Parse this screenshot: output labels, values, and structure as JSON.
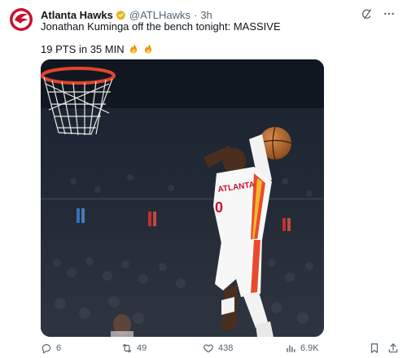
{
  "tweet": {
    "author_name": "Atlanta Hawks",
    "handle": "@ATLHawks",
    "separator": "·",
    "time": "3h",
    "text_line1": "Jonathan Kuminga off the bench tonight: MASSIVE",
    "text_line2": "19 PTS in 35 MIN",
    "photo": {
      "jersey_team": "ATLANTA",
      "jersey_number": "0"
    }
  },
  "actions": {
    "replies": "6",
    "reposts": "49",
    "likes": "438",
    "views": "6.9K"
  },
  "colors": {
    "hawks_red": "#c8102e",
    "verified_gold": "#e2b719",
    "secondary_text": "#536471"
  },
  "icons": {
    "avatar": "hawks-logo",
    "verified": "verified-badge-icon",
    "grok": "grok-icon",
    "more": "more-icon",
    "emoji": "fire-emoji",
    "reply": "reply-icon",
    "repost": "repost-icon",
    "like": "like-icon",
    "views": "views-icon",
    "bookmark": "bookmark-icon",
    "share": "share-icon"
  }
}
